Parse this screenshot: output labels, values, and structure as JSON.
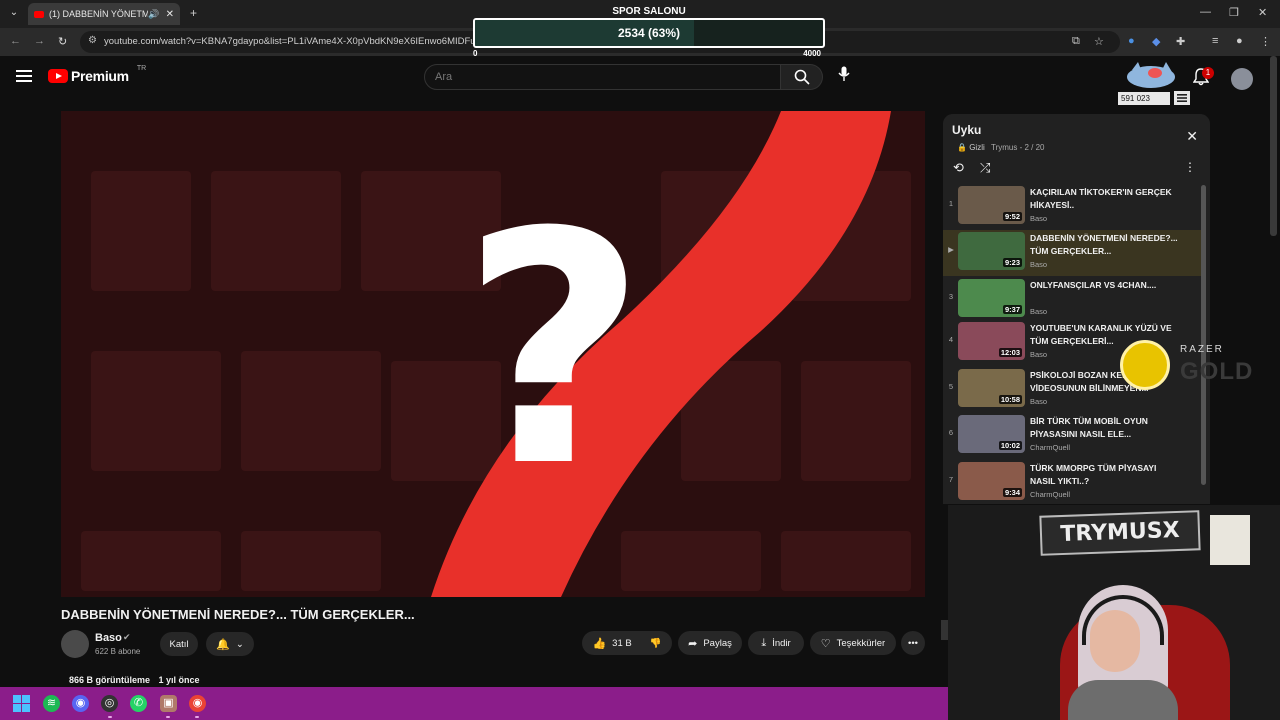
{
  "browser": {
    "tab_title": "(1) DABBENİN YÖNETMENİ",
    "url": "youtube.com/watch?v=KBNA7gdaypo&list=PL1iVAme4X-X0pVbdKN9eX6IEnwo6MIDFu&"
  },
  "overlay": {
    "title": "SPOR SALONU",
    "value_text": "2534 (63%)",
    "min": "0",
    "max": "4000",
    "progress": 0.63
  },
  "youtube": {
    "logo_text": "Premium",
    "logo_region": "TR",
    "search_placeholder": "Ara",
    "viewer_count": "591 023",
    "notification_count": "1"
  },
  "video": {
    "title": "DABBENİN YÖNETMENİ NEREDE?... TÜM GERÇEKLER...",
    "overlay_glyph": "?",
    "channel": "Baso",
    "subscribers": "622 B abone",
    "join_label": "Katıl",
    "likes": "31 B",
    "share_label": "Paylaş",
    "download_label": "İndir",
    "thanks_label": "Teşekkürler",
    "views": "866 B görüntüleme",
    "date": "1 yıl önce"
  },
  "playlist": {
    "title": "Uyku",
    "privacy": "Gizli",
    "owner_position": "Trymus - 2 / 20",
    "items": [
      {
        "index": "1",
        "title": "KAÇIRILAN TİKTOKER'IN GERÇEK HİKAYESİ..",
        "channel": "Baso",
        "duration": "9:52",
        "color": "#6a5a4a"
      },
      {
        "index": "▶",
        "title": "DABBENİN YÖNETMENİ NEREDE?... TÜM GERÇEKLER...",
        "channel": "Baso",
        "duration": "9:23",
        "color": "#3f6a3f"
      },
      {
        "index": "3",
        "title": "ONLYFANSÇILAR VS 4CHAN....",
        "channel": "Baso",
        "duration": "9:37",
        "color": "#4d8a4d"
      },
      {
        "index": "4",
        "title": "YOUTUBE'UN KARANLIK YÜZÜ VE TÜM GERÇEKLERİ...",
        "channel": "Baso",
        "duration": "12:03",
        "color": "#8a4a5a"
      },
      {
        "index": "5",
        "title": "PSİKOLOJİ BOZAN KEDİ VİDEOSUNUN BİLİNMEYEN...",
        "channel": "Baso",
        "duration": "10:58",
        "color": "#7a6a4a"
      },
      {
        "index": "6",
        "title": "BİR TÜRK TÜM MOBİL OYUN PİYASASINI NASIL ELE...",
        "channel": "CharmQuell",
        "duration": "10:02",
        "color": "#6a6a7a"
      },
      {
        "index": "7",
        "title": "TÜRK MMORPG TÜM PİYASAYI NASIL YIKTI..?",
        "channel": "CharmQuell",
        "duration": "9:34",
        "color": "#8a5a4a"
      }
    ]
  },
  "sponsor": {
    "brand": "RAZER",
    "sub": "GOLD"
  },
  "webcam": {
    "sign_text": "TRYMUSX"
  }
}
